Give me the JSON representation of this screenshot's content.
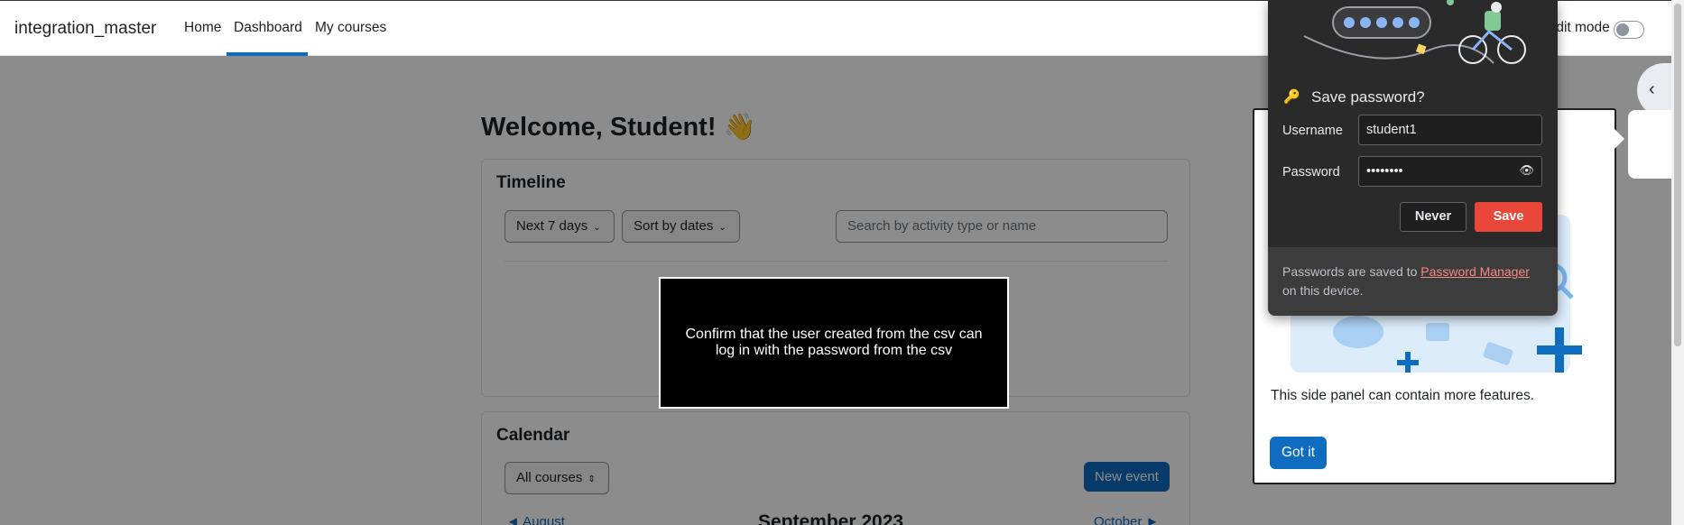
{
  "navbar": {
    "brand": "integration_master",
    "items": [
      {
        "label": "Home"
      },
      {
        "label": "Dashboard"
      },
      {
        "label": "My courses"
      }
    ],
    "edit_mode_label": "Edit mode"
  },
  "main": {
    "welcome": "Welcome, Student! 👋",
    "timeline": {
      "title": "Timeline",
      "filter_days": "Next 7 days",
      "sort": "Sort by dates",
      "search_placeholder": "Search by activity type or name"
    },
    "calendar": {
      "title": "Calendar",
      "course_filter": "All courses",
      "new_event": "New event",
      "prev_month": "◄ August",
      "current_month": "September 2023",
      "next_month": "October ►"
    }
  },
  "tooltip": {
    "text": "Confirm that the user created from the csv can log in with the password from the csv"
  },
  "side_panel": {
    "text": "This side panel can contain more features.",
    "button": "Got it"
  },
  "password_popup": {
    "title": "Save password?",
    "username_label": "Username",
    "username_value": "student1",
    "password_label": "Password",
    "password_value": "••••••••",
    "never_button": "Never",
    "save_button": "Save",
    "footer_prefix": "Passwords are saved to ",
    "footer_link": "Password Manager",
    "footer_suffix": " on this device."
  },
  "colors": {
    "primary": "#0f6cbf",
    "save_red": "#e9473a",
    "popup_bg": "#2a2a2b"
  }
}
